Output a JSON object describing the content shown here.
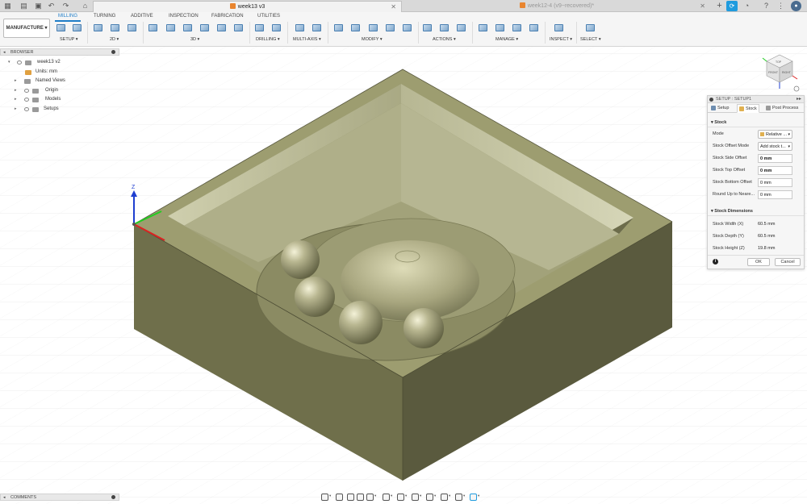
{
  "tabbar": {
    "active_tab": "week13 v3",
    "inactive_tab": "week12-4 (v9~recovered)*"
  },
  "ribbon": {
    "workspace": "MANUFACTURE ▾",
    "tabs": [
      "MILLING",
      "TURNING",
      "ADDITIVE",
      "INSPECTION",
      "FABRICATION",
      "UTILITIES"
    ],
    "groups": [
      "SETUP ▾",
      "2D ▾",
      "3D ▾",
      "DRILLING ▾",
      "MULTI-AXIS ▾",
      "MODIFY ▾",
      "ACTIONS ▾",
      "MANAGE ▾",
      "INSPECT ▾",
      "SELECT ▾"
    ]
  },
  "browser": {
    "title": "BROWSER",
    "root": "week13 v2",
    "items": [
      "Units: mm",
      "Named Views",
      "Origin",
      "Models",
      "Setups"
    ]
  },
  "setup_dialog": {
    "title": "SETUP : SETUP1",
    "tabs": [
      "Setup",
      "Stock",
      "Post Process"
    ],
    "stock_section": "Stock",
    "fields": [
      {
        "label": "Mode",
        "value": "Relative ..."
      },
      {
        "label": "Stock Offset Mode",
        "value": "Add stock t..."
      },
      {
        "label": "Stock Side Offset",
        "value": "0 mm"
      },
      {
        "label": "Stock Top Offset",
        "value": "0 mm"
      },
      {
        "label": "Stock Bottom Offset",
        "value": "0 mm"
      },
      {
        "label": "Round Up to Neare...",
        "value": "0 mm"
      }
    ],
    "dims_section": "Stock Dimensions",
    "dims": [
      {
        "label": "Stock Width (X)",
        "value": "60.5 mm"
      },
      {
        "label": "Stock Depth (Y)",
        "value": "60.5 mm"
      },
      {
        "label": "Stock Height (Z)",
        "value": "19.8 mm"
      }
    ],
    "ok": "OK",
    "cancel": "Cancel"
  },
  "viewcube": {
    "top": "TOP",
    "front": "FRONT",
    "right": "RIGHT"
  },
  "axes": {
    "z": "Z"
  },
  "comments": {
    "title": "COMMENTS"
  },
  "colors": {
    "model_top": "#9a9a6c",
    "model_left": "#6f6f4b",
    "model_right": "#5a5a3e",
    "accent": "#1f7dc8"
  }
}
